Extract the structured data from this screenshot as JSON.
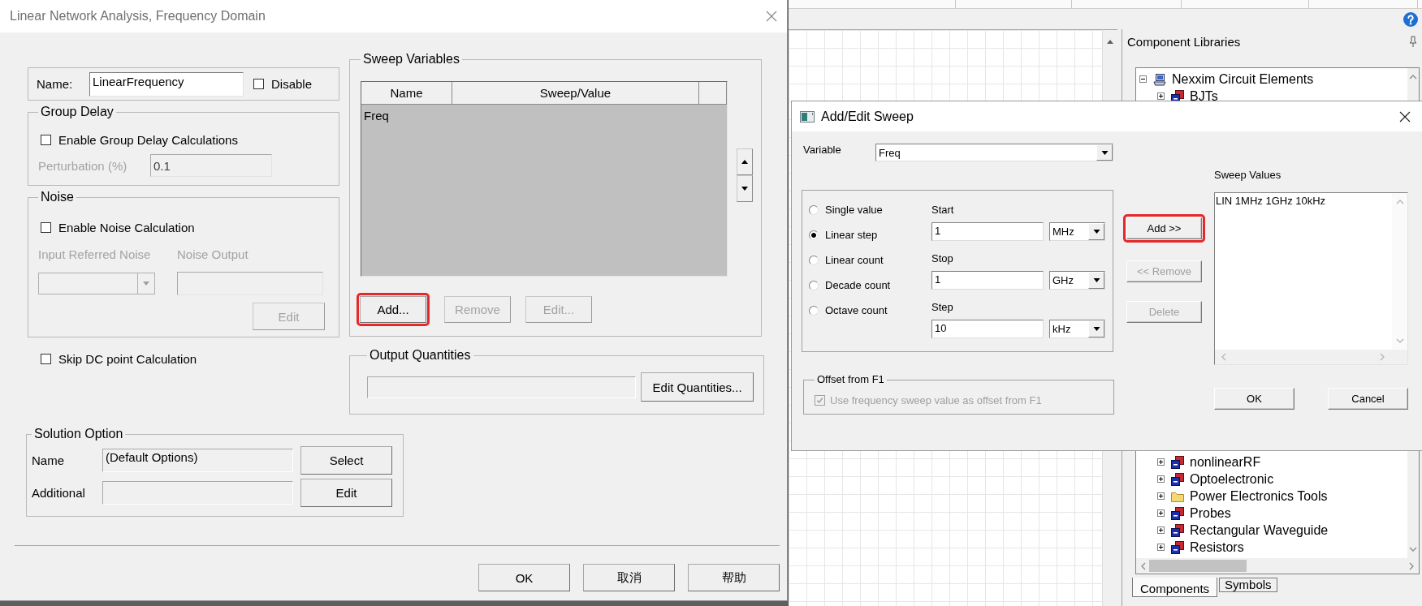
{
  "main_dialog": {
    "title": "Linear Network Analysis, Frequency Domain",
    "name_label": "Name:",
    "name_value": "LinearFrequency",
    "disable": {
      "label": "Disable",
      "checked": false
    },
    "group_delay": {
      "title": "Group Delay",
      "enable": {
        "label": "Enable Group Delay Calculations",
        "checked": false
      },
      "perturbation": {
        "label": "Perturbation (%)",
        "value": "0.1",
        "disabled": true
      }
    },
    "noise": {
      "title": "Noise",
      "enable": {
        "label": "Enable Noise Calculation",
        "checked": false
      },
      "input_label": "Input Referred Noise",
      "output_label": "Noise Output",
      "disabled": true,
      "edit_button": {
        "label": "Edit",
        "disabled": true
      }
    },
    "skip_dc": {
      "label": "Skip DC point Calculation",
      "checked": false
    },
    "sweep_variables": {
      "title": "Sweep Variables",
      "columns": [
        "Name",
        "Sweep/Value"
      ],
      "rows": [
        {
          "cells": [
            "Freq"
          ]
        }
      ],
      "buttons": [
        {
          "label": "Add...",
          "disabled": false,
          "highlighted": true
        },
        {
          "label": "Remove",
          "disabled": true,
          "highlighted": false
        },
        {
          "label": "Edit...",
          "disabled": true,
          "highlighted": false
        }
      ]
    },
    "output_quantities": {
      "title": "Output Quantities",
      "button": "Edit Quantities..."
    },
    "solution_option": {
      "title": "Solution Option",
      "rows": [
        {
          "label": "Name",
          "value": "(Default Options)",
          "button": "Select"
        },
        {
          "label": "Additional",
          "button": "Edit"
        }
      ]
    },
    "buttons": [
      "OK",
      "取消",
      "帮助"
    ]
  },
  "sweep_dialog": {
    "title": "Add/Edit Sweep",
    "variable_label": "Variable",
    "variable_value": "Freq",
    "modes": [
      {
        "label": "Single value",
        "selected": false
      },
      {
        "label": "Linear step",
        "selected": true
      },
      {
        "label": "Linear count",
        "selected": false
      },
      {
        "label": "Decade count",
        "selected": false
      },
      {
        "label": "Octave count",
        "selected": false
      }
    ],
    "ranges": [
      {
        "label": "Start",
        "value": "1",
        "unit": "MHz"
      },
      {
        "label": "Stop",
        "value": "1",
        "unit": "GHz"
      },
      {
        "label": "Step",
        "value": "10",
        "unit": "kHz"
      }
    ],
    "offset": {
      "title": "Offset from F1",
      "label": "Use frequency sweep value as offset from F1",
      "checked": true,
      "disabled": true
    },
    "buttons": [
      {
        "label": "Add >>",
        "disabled": false,
        "highlighted": true
      },
      {
        "label": "<< Remove",
        "disabled": true,
        "highlighted": false
      },
      {
        "label": "Delete",
        "disabled": true,
        "highlighted": false
      }
    ],
    "values_label": "Sweep Values",
    "values": [
      "LIN 1MHz 1GHz 10kHz"
    ],
    "footer_buttons": [
      "OK",
      "Cancel"
    ]
  },
  "app": {
    "panel_title": "Component Libraries",
    "tree": [
      {
        "label": "Nexxim Circuit Elements",
        "kind": "computer",
        "expanded": true,
        "children": [
          {
            "label": "BJTs",
            "kind": "library",
            "expanded": false
          },
          {
            "label": "nonlinearRF",
            "kind": "library",
            "expanded": false
          },
          {
            "label": "Optoelectronic",
            "kind": "library",
            "expanded": false
          },
          {
            "label": "Power Electronics Tools",
            "kind": "folder",
            "expanded": false
          },
          {
            "label": "Probes",
            "kind": "library",
            "expanded": false
          },
          {
            "label": "Rectangular Waveguide",
            "kind": "library",
            "expanded": false
          },
          {
            "label": "Resistors",
            "kind": "library",
            "expanded": false
          }
        ]
      }
    ],
    "tabs": [
      {
        "label": "Components",
        "selected": true
      },
      {
        "label": "Symbols",
        "selected": false
      }
    ]
  }
}
